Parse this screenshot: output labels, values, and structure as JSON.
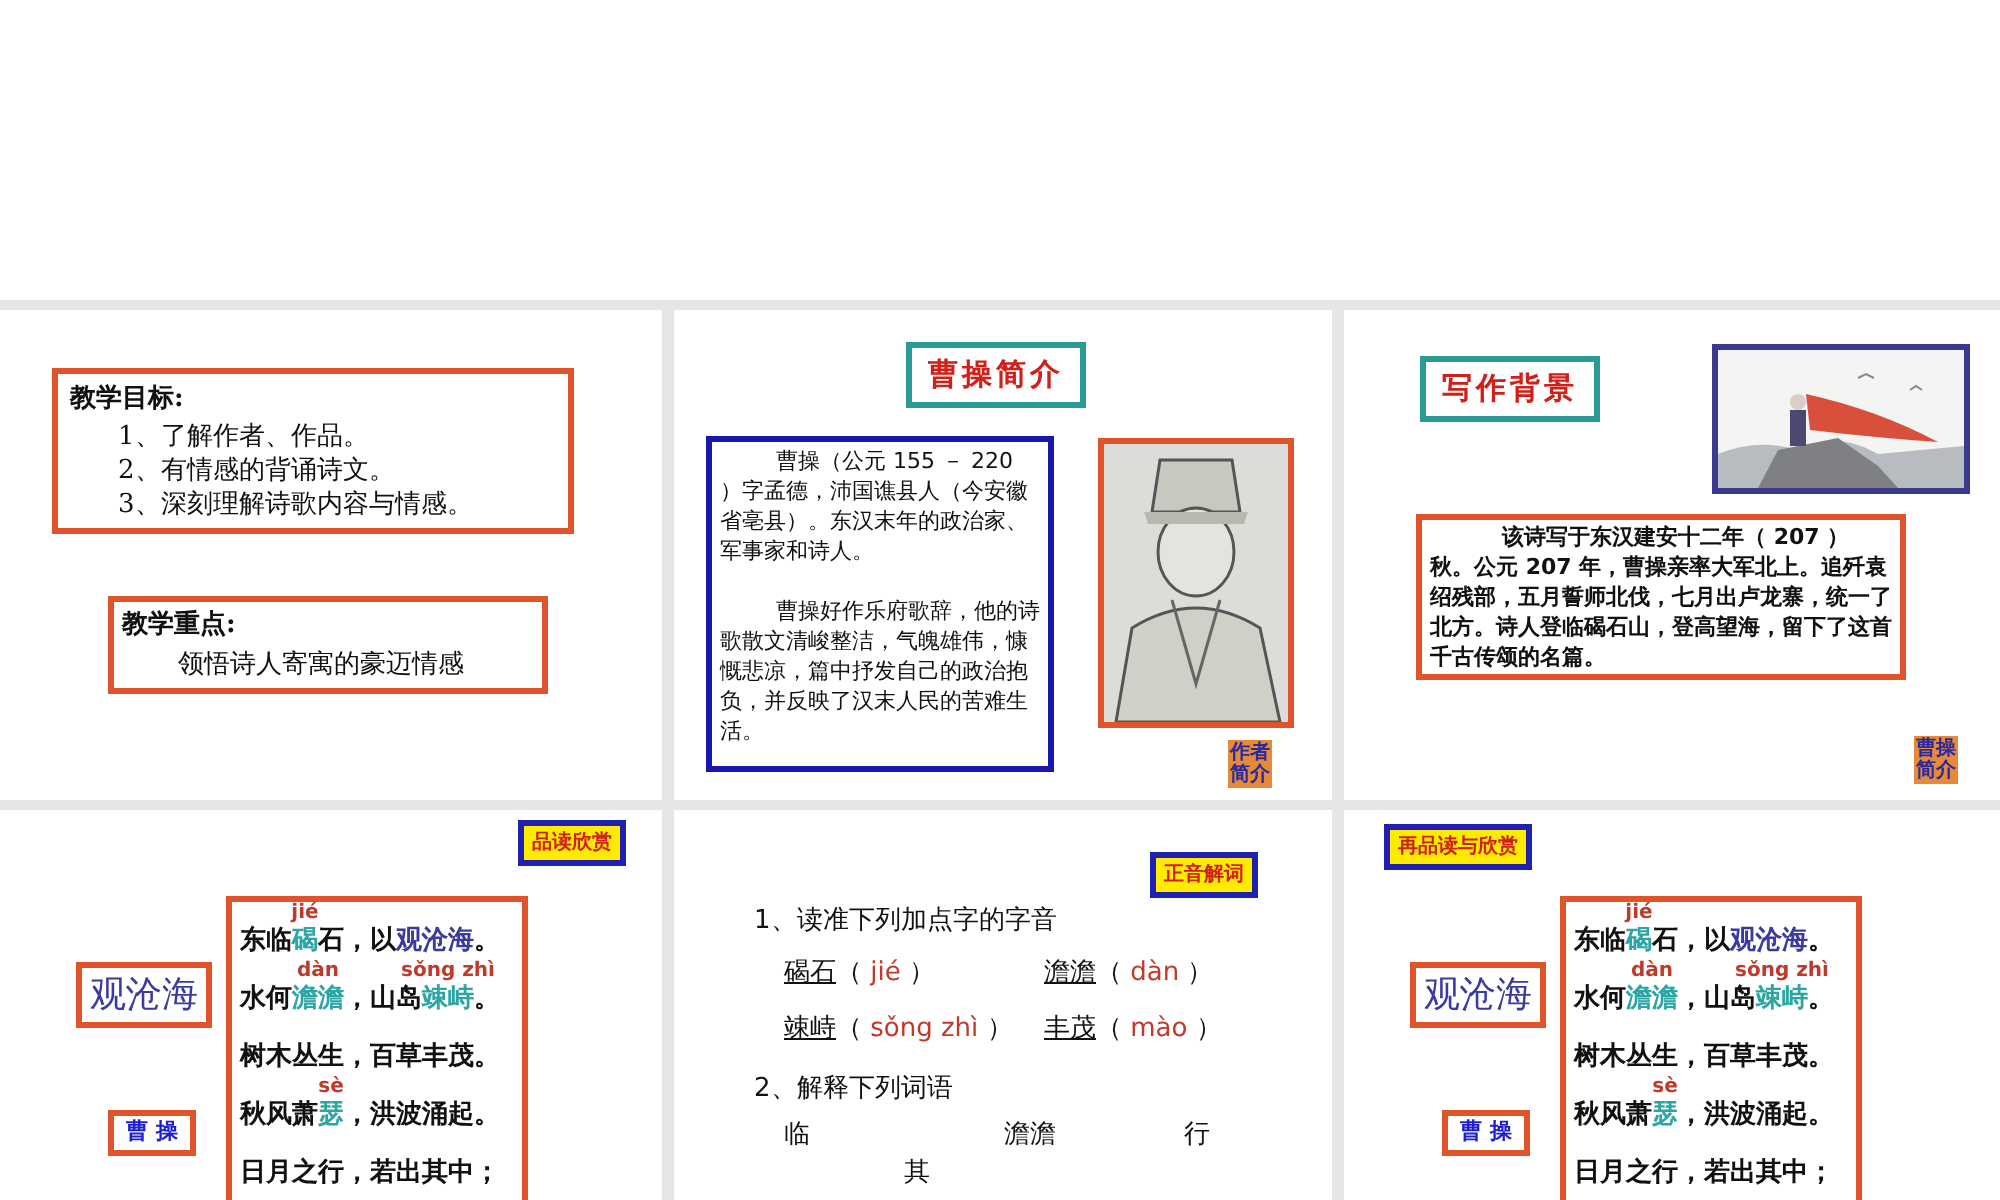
{
  "slides": [
    {
      "kind": "objectives",
      "goals": {
        "heading": "教学目标:",
        "items": [
          "1、了解作者、作品。",
          "2、有情感的背诵诗文。",
          "3、深刻理解诗歌内容与情感。"
        ]
      },
      "focus": {
        "heading": "教学重点:",
        "text": "领悟诗人寄寓的豪迈情感"
      }
    },
    {
      "kind": "author",
      "title": "曹操简介",
      "paragraphs": [
        "曹操（公元 155 － 220 ）字孟德，沛国谯县人（今安徽省亳县）。东汉末年的政治家、军事家和诗人。",
        "曹操好作乐府歌辞，他的诗歌散文清峻整洁，气魄雄伟，慷慨悲凉，篇中抒发自己的政治抱负，并反映了汉末人民的苦难生活。"
      ],
      "nav_button": "作者简介"
    },
    {
      "kind": "background",
      "title": "写作背景",
      "paragraph": "该诗写于东汉建安十二年（ 207 ）秋。公元 207 年，曹操亲率大军北上。追歼袁绍残部，五月誓师北伐，七月出卢龙寨，统一了北方。诗人登临碣石山，登高望海，留下了这首千古传颂的名篇。",
      "nav_button": "曹操简介"
    },
    {
      "kind": "poem",
      "tag": "品读欣赏",
      "poem_title": "观沧海",
      "author": "曹 操",
      "lines": [
        [
          {
            "text": "东临"
          },
          {
            "text": "碣",
            "kind": "key",
            "pinyin": "jié"
          },
          {
            "text": "石，以"
          },
          {
            "text": "观沧海",
            "kind": "title"
          },
          {
            "text": "。"
          }
        ],
        [
          {
            "text": "水何"
          },
          {
            "text": "澹澹",
            "kind": "key",
            "pinyin": "dàn"
          },
          {
            "text": "，山岛"
          },
          {
            "text": "竦峙",
            "kind": "key",
            "pinyin": "sǒng zhì"
          },
          {
            "text": "。"
          }
        ],
        [
          {
            "text": "树木丛生，百草丰茂。"
          }
        ],
        [
          {
            "text": "秋风萧"
          },
          {
            "text": "瑟",
            "kind": "key",
            "pinyin": "sè"
          },
          {
            "text": "，洪波涌起。"
          }
        ],
        [
          {
            "text": "日月之行，若出其中；"
          }
        ]
      ]
    },
    {
      "kind": "exercise",
      "tag": "正音解词",
      "heading": "1、读准下列加点字的字音",
      "pairs": [
        {
          "word": "碣石",
          "open": "（",
          "pinyin": "jié",
          "close": "）"
        },
        {
          "word": "澹澹",
          "open": "（",
          "pinyin": "dàn",
          "close": "）"
        },
        {
          "word": "竦峙",
          "open": "（",
          "pinyin": "sǒng zhì",
          "close": "）"
        },
        {
          "word": "丰茂",
          "open": "（",
          "pinyin": "mào",
          "close": "）"
        }
      ],
      "heading2": "2、解释下列词语",
      "words": [
        "临",
        "澹澹",
        "行",
        "其"
      ]
    },
    {
      "kind": "poem",
      "tag": "再品读与欣赏",
      "poem_title": "观沧海",
      "author": "曹 操",
      "lines": [
        [
          {
            "text": "东临"
          },
          {
            "text": "碣",
            "kind": "key",
            "pinyin": "jié"
          },
          {
            "text": "石，以"
          },
          {
            "text": "观沧海",
            "kind": "title"
          },
          {
            "text": "。"
          }
        ],
        [
          {
            "text": "水何"
          },
          {
            "text": "澹澹",
            "kind": "key",
            "pinyin": "dàn"
          },
          {
            "text": "，山岛"
          },
          {
            "text": "竦峙",
            "kind": "key",
            "pinyin": "sǒng zhì"
          },
          {
            "text": "。"
          }
        ],
        [
          {
            "text": "树木丛生，百草丰茂。"
          }
        ],
        [
          {
            "text": "秋风萧"
          },
          {
            "text": "瑟",
            "kind": "key",
            "pinyin": "sè"
          },
          {
            "text": "，洪波涌起。"
          }
        ],
        [
          {
            "text": "日月之行，若出其中；"
          }
        ]
      ]
    }
  ]
}
